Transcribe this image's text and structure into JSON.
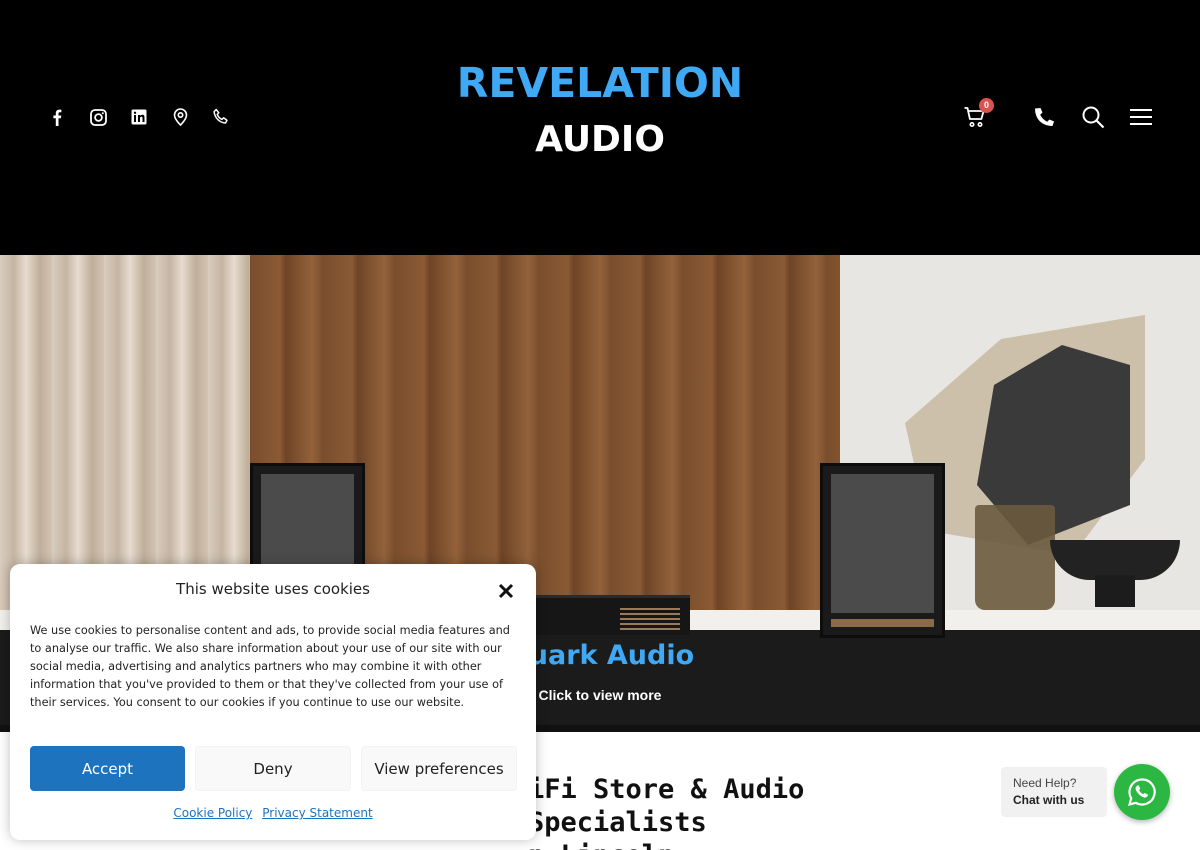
{
  "header": {
    "logo_line1": "REVELATION",
    "logo_line2": "AUDIO",
    "social_icons": [
      "facebook-icon",
      "instagram-icon",
      "linkedin-icon",
      "map-pin-icon",
      "phone-outline-icon"
    ],
    "cart_count": "0",
    "right_icons": [
      "cart-icon",
      "phone-icon",
      "search-icon",
      "menu-icon"
    ],
    "brand_color": "#3fa9f5"
  },
  "hero": {
    "title": "Quark Audio",
    "cta": "Click to view more"
  },
  "main": {
    "headline_line1": "iFi Store & Audio Specialists",
    "headline_line2": "n Lincoln"
  },
  "chat": {
    "help_line1": "Need Help?",
    "help_line2": "Chat with us",
    "icon": "whatsapp-icon",
    "color": "#2cb742"
  },
  "cookie": {
    "title": "This website uses cookies",
    "body": "We use cookies to personalise content and ads, to provide social media features and to analyse our traffic. We also share information about your use of our site with our social media, advertising and analytics partners who may combine it with other information that you've provided to them or that they've collected from your use of their services. You consent to our cookies if you continue to use our website.",
    "accept_label": "Accept",
    "deny_label": "Deny",
    "preferences_label": "View preferences",
    "cookie_policy_link": "Cookie Policy",
    "privacy_link": "Privacy Statement",
    "accent_color": "#1e73be"
  }
}
